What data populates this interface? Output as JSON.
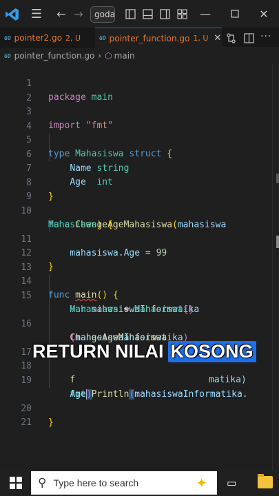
{
  "titlebar": {
    "search_text": "godas",
    "icons": [
      "vscode-logo",
      "menu-icon",
      "back-arrow-icon",
      "forward-arrow-icon",
      "layout-sidebar-left-icon",
      "layout-panel-icon",
      "layout-sidebar-right-icon",
      "customize-layout-icon",
      "minimize-icon",
      "maximize-icon",
      "close-icon"
    ]
  },
  "tabs": [
    {
      "icon": "GO",
      "name": "pointer2.go",
      "status": "2, U",
      "active": false
    },
    {
      "icon": "GO",
      "name": "pointer_function.go",
      "status": "1, U",
      "active": true,
      "close": "✕"
    }
  ],
  "breadcrumb": {
    "icon": "GO",
    "file": "pointer_function.go",
    "sep": "›",
    "symbol": "main"
  },
  "line_numbers": [
    "1",
    "2",
    "3",
    "4",
    "5",
    "6",
    "7",
    "8",
    "9",
    "10",
    "",
    "11",
    "12",
    "13",
    "14",
    "15",
    "",
    "16",
    "",
    "17",
    "18",
    "19",
    "",
    "20",
    "21"
  ],
  "code": {
    "l1_kw": "package",
    "l1_name": "main",
    "l3_kw": "import",
    "l3_str": "\"fmt\"",
    "l5_kw": "type",
    "l5_type": "Mahasiswa",
    "l5_kw2": "struct",
    "l5_brace": "{",
    "l6_field": "Name",
    "l6_type": "string",
    "l7_field": "Age",
    "l7_type": "int",
    "l8_brace": "}",
    "l10_kw": "func",
    "l10_fn": "ChangeAgeMahasiswa",
    "l10_paren": "(",
    "l10_param": "mahasiswa",
    "l10b_type": "Mahasiswa",
    "l10b_paren": ")",
    "l10b_brace": "{",
    "l11_var": "mahasiswa",
    "l11_dot": ".",
    "l11_field": "Age",
    "l11_eq": " = ",
    "l11_num": "99",
    "l12_brace": "}",
    "l14_kw": "func",
    "l14_fn": "main",
    "l14_parens": "()",
    "l14_brace": "{",
    "l15_kw": "var",
    "l15_var": "mahasiswaInformatika",
    "l15b_type": "Mahasiswa",
    "l15b_eq": " = ",
    "l15b_type2": "Mahasiswa",
    "l15b_braces": "{}",
    "l16_fn": "ChangeAgeMahasiswa",
    "l16b_open": "(",
    "l16b_var": "mahasiswaInformatika",
    "l16b_close": ")",
    "l18_partial": "f",
    "l18_tail": "matika)",
    "l19_pkg": "fmt",
    "l19_dot": ".",
    "l19_fn": "Println",
    "l19_open": "(",
    "l19_var": "mahasiswaInformatika",
    "l19_dot2": ".",
    "l19b_field": "Age",
    "l19b_close": ")",
    "l20_brace": "}"
  },
  "caption": {
    "text": "RETURN NILAI",
    "highlight": "KOSONG"
  },
  "taskbar": {
    "search_placeholder": "Type here to search"
  }
}
